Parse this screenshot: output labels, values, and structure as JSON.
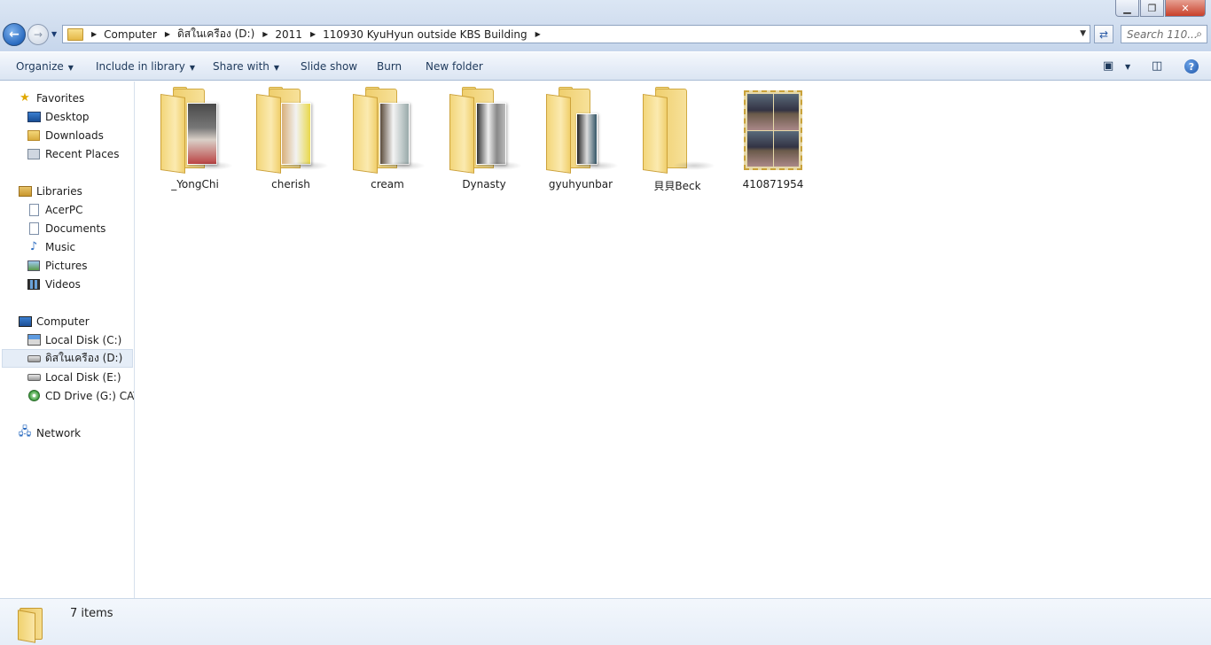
{
  "address": {
    "crumbs": [
      "Computer",
      "ดิสในเครือง (D:)",
      "2011",
      "110930 KyuHyun outside KBS Building"
    ]
  },
  "search": {
    "placeholder": "Search 110..."
  },
  "toolbar": {
    "organize": "Organize",
    "include_in_library": "Include in library",
    "share_with": "Share with",
    "slide_show": "Slide show",
    "burn": "Burn",
    "new_folder": "New folder",
    "help": "?"
  },
  "nav": {
    "favorites": "Favorites",
    "desktop": "Desktop",
    "downloads": "Downloads",
    "recent_places": "Recent Places",
    "libraries": "Libraries",
    "acerpc": "AcerPC",
    "documents": "Documents",
    "music": "Music",
    "pictures": "Pictures",
    "videos": "Videos",
    "computer": "Computer",
    "local_disk_c": "Local Disk (C:)",
    "disk_d": "ดิสในเครือง (D:)",
    "local_disk_e": "Local Disk (E:)",
    "cd_drive": "CD Drive (G:) CAT (",
    "network": "Network"
  },
  "items": [
    "_YongChi",
    "cherish",
    "cream",
    "Dynasty",
    "gyuhyunbar",
    "貝貝Beck",
    "410871954"
  ],
  "status": {
    "count": "7 items"
  },
  "colors": {
    "accent": "#2a6bc0",
    "folder": "#f3d67a",
    "selection": "#e5edf7"
  }
}
